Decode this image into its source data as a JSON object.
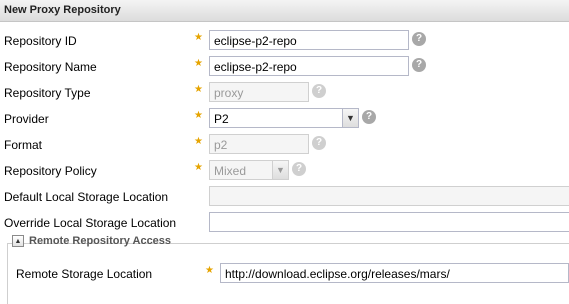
{
  "panel": {
    "title": "New Proxy Repository"
  },
  "fields": {
    "repository_id": {
      "label": "Repository ID",
      "value": "eclipse-p2-repo"
    },
    "repository_name": {
      "label": "Repository Name",
      "value": "eclipse-p2-repo"
    },
    "repository_type": {
      "label": "Repository Type",
      "value": "proxy"
    },
    "provider": {
      "label": "Provider",
      "value": "P2"
    },
    "format": {
      "label": "Format",
      "value": "p2"
    },
    "repository_policy": {
      "label": "Repository Policy",
      "value": "Mixed"
    },
    "default_storage": {
      "label": "Default Local Storage Location",
      "value": ""
    },
    "override_storage": {
      "label": "Override Local Storage Location",
      "value": ""
    }
  },
  "remote_section": {
    "legend": "Remote Repository Access",
    "remote_storage": {
      "label": "Remote Storage Location",
      "value": "http://download.eclipse.org/releases/mars/"
    }
  },
  "icons": {
    "required": "star-icon",
    "help": "question-icon",
    "collapse": "collapse-icon",
    "dropdown": "chevron-down-icon"
  },
  "colors": {
    "required_star": "#e6a400",
    "help_icon": "#a8a8a8",
    "header_bg": "#dcdcdc"
  },
  "glyphs": {
    "star": "★",
    "help": "?",
    "arrow": "▼",
    "collapse": "▲"
  }
}
